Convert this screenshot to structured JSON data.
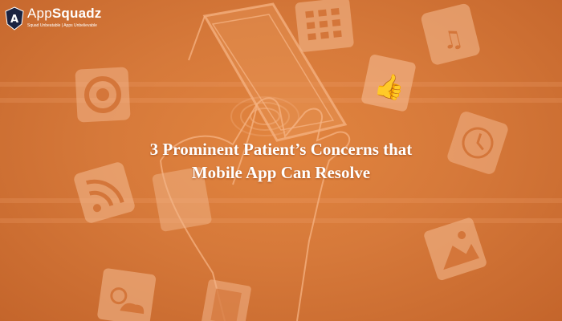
{
  "brand": {
    "name_part1": "App",
    "name_part2": "Squadz",
    "badge_letter": "A",
    "tagline": "Squad Unbeatable | Apps Unbelievable"
  },
  "headline": {
    "line1": "3 Prominent Patient’s Concerns that",
    "line2": "Mobile App Can Resolve"
  },
  "colors": {
    "background": "#d6793a",
    "icon_tile": "#f2b58a",
    "text": "#ffffff",
    "logo_badge": "#1b2340"
  },
  "icons": [
    "target-icon",
    "keypad-icon",
    "music-note-icon",
    "thumbs-up-icon",
    "clock-icon",
    "rss-icon",
    "phone-screen-icon",
    "image-icon",
    "weather-icon",
    "film-icon",
    "hand-phone-illustration"
  ]
}
